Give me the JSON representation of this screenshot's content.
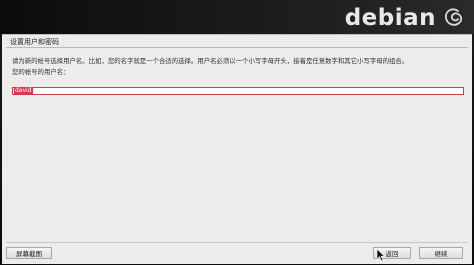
{
  "brand": {
    "logo_text": "debian",
    "swirl_icon": "debian-swirl-icon",
    "swirl_color": "#b70f35"
  },
  "dialog": {
    "title": "设置用户和密码",
    "info": "请为新的帐号选择用户名。比如，您的名字就是一个合适的选择。用户名必须以一个小写字母开头，接着是任意数字和其它小写字母的组合。",
    "prompt": "您的帐号的用户名：",
    "username_value": "david"
  },
  "buttons": {
    "screenshot": "屏幕截图",
    "back": "返回",
    "continue": "继续"
  },
  "colors": {
    "selection": "#d83a55",
    "focus_border": "#cf3a4a"
  }
}
